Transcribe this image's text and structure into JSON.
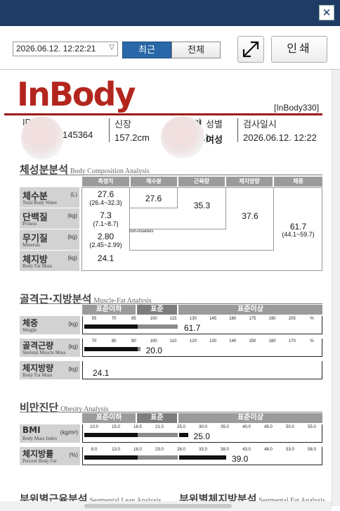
{
  "window": {
    "close_glyph": "✕"
  },
  "toolbar": {
    "date_value": "2026.06.12.  12:22:21",
    "tab_recent": "최근",
    "tab_all": "전체",
    "print_label": "인쇄",
    "expand_icon": "expand-diagonal-icon"
  },
  "report": {
    "logo": "InBody",
    "model": "[InBody330]",
    "id_label": "ID",
    "id_value": "145364",
    "height_label": "신장",
    "height_value": "157.2cm",
    "age_label": "연령",
    "age_value": "5.)",
    "sex_label": "성별",
    "sex_value": "여성",
    "date_label": "검사일시",
    "date_value": "2026.06.12. 12:22"
  },
  "body_comp": {
    "title": "체성분분석",
    "subtitle": "Body Composition Analysis",
    "headers": [
      "측정치",
      "체수분",
      "근육량",
      "제지방량",
      "체중"
    ],
    "rows": [
      {
        "ko": "체수분",
        "en": "Total Body Water",
        "unit": "(L)",
        "value": "27.6",
        "range": "(26.4~32.3)"
      },
      {
        "ko": "단백질",
        "en": "Protein",
        "unit": "(kg)",
        "value": "7.3",
        "range": "(7.1~8.7)"
      },
      {
        "ko": "무기질",
        "en": "Minerals",
        "unit": "(kg)",
        "value": "2.80",
        "range": "(2.45~2.99)"
      },
      {
        "ko": "체지방",
        "en": "Body Fat Mass",
        "unit": "(kg)",
        "value": "24.1",
        "range": ""
      }
    ],
    "water_total": "27.6",
    "muscle_mass": "35.3",
    "ffm": "37.6",
    "weight": "61.7",
    "weight_range": "(44.1~59.7)",
    "non_osseous": "non-osseous"
  },
  "muscle_fat": {
    "title": "골격근·지방분석",
    "subtitle": "Muscle-Fat Analysis",
    "band": [
      "표준이하",
      "표준",
      "표준이상"
    ],
    "rows": [
      {
        "ko": "체중",
        "en": "Weight",
        "unit": "(kg)",
        "ticks": [
          "55",
          "70",
          "85",
          "100",
          "115",
          "130",
          "145",
          "160",
          "175",
          "190",
          "205",
          "%"
        ],
        "value": "61.7",
        "fill_pct": 40
      },
      {
        "ko": "골격근량",
        "en": "Skeletal Muscle Mass",
        "unit": "(kg)",
        "ticks": [
          "70",
          "80",
          "90",
          "100",
          "110",
          "120",
          "130",
          "140",
          "150",
          "160",
          "170",
          "%"
        ],
        "value": "20.0",
        "fill_pct": 24
      },
      {
        "ko": "체지방량",
        "en": "Body Fat Mass",
        "unit": "(kg)",
        "ticks": [],
        "value": "24.1",
        "fill_pct": 0
      }
    ]
  },
  "obesity": {
    "title": "비만진단",
    "subtitle": "Obesity Analysis",
    "band": [
      "표준이하",
      "표준",
      "표준이상"
    ],
    "rows": [
      {
        "ko": "BMI",
        "en": "Body Mass Index",
        "unit": "(kg/m²)",
        "ticks": [
          "10.0",
          "15.0",
          "18.5",
          "21.0",
          "25.0",
          "30.0",
          "35.0",
          "40.0",
          "45.0",
          "50.0",
          "55.0"
        ],
        "value": "25.0",
        "fill_pct": 44
      },
      {
        "ko": "체지방률",
        "en": "Percent Body Fat",
        "unit": "(%)",
        "ticks": [
          "8.0",
          "13.0",
          "18.0",
          "23.0",
          "28.0",
          "33.0",
          "38.0",
          "43.0",
          "48.0",
          "53.0",
          "58.0"
        ],
        "value": "39.0",
        "fill_pct": 60
      }
    ]
  },
  "bottom": {
    "left_title": "부위별근육분석",
    "left_sub": "Segmental Lean Analysis",
    "right_title": "부위별체지방분석",
    "right_sub": "Segmental Fat Analysis"
  }
}
